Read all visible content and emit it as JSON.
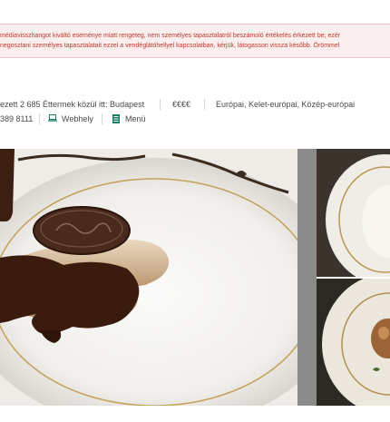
{
  "alert": {
    "line1": "médiavisszhangot kiváltó eseménye miatt rengeteg, nem személyes tapasztalatról beszámoló értékelés érkezett be; ezér",
    "line2": "negosztani személyes tapasztalatait ezzel a vendéglátóhellyel kapcsolatban, kérjük, látogasson vissza később. Örömmel"
  },
  "info": {
    "ranking": "ezett 2 685 Éttermek közül itt: Budapest",
    "price": "€€€€",
    "cuisines": "Európai, Kelet-európai, Közép-európai",
    "phone": "389 8111",
    "website_label": "Webhely",
    "menu_label": "Menü"
  },
  "colors": {
    "alert_text": "#c0392b",
    "alert_bg": "#fbeeee",
    "icon_accent": "#1a7f64"
  },
  "icons": [
    "laptop-icon",
    "menu-book-icon"
  ]
}
